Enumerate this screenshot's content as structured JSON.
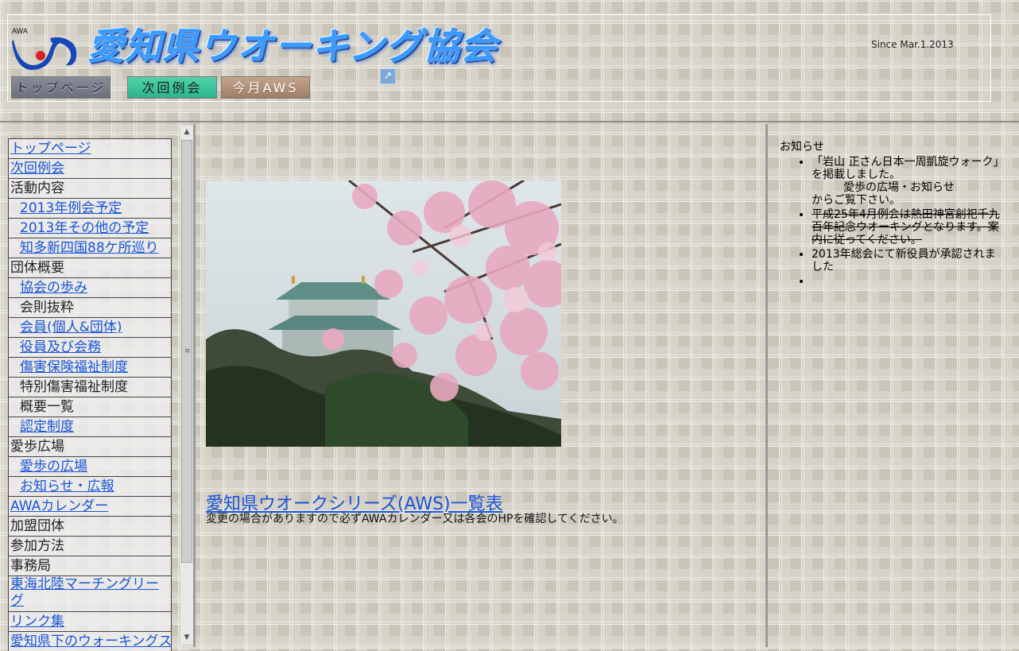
{
  "header": {
    "logo_text": "AWA",
    "site_title": "愛知県ウオーキング協会",
    "since": "Since Mar.1.2013",
    "nav": [
      {
        "label": "トップページ"
      },
      {
        "label": "次回例会"
      },
      {
        "label": "今月AWS"
      }
    ]
  },
  "sidebar": {
    "items": [
      {
        "label": "トップページ",
        "kind": "link",
        "level": 0
      },
      {
        "label": "次回例会",
        "kind": "link",
        "level": 0
      },
      {
        "label": "活動内容",
        "kind": "static",
        "level": 0
      },
      {
        "label": "2013年例会予定",
        "kind": "link",
        "level": 1
      },
      {
        "label": "2013年その他の予定",
        "kind": "link",
        "level": 1
      },
      {
        "label": "知多新四国88ケ所巡り",
        "kind": "link",
        "level": 1
      },
      {
        "label": "団体概要",
        "kind": "static",
        "level": 0
      },
      {
        "label": "協会の歩み",
        "kind": "link",
        "level": 1
      },
      {
        "label": "会則抜粋",
        "kind": "static",
        "level": 1
      },
      {
        "label": "会員(個人&団体)",
        "kind": "link",
        "level": 1
      },
      {
        "label": "役員及び会務",
        "kind": "link",
        "level": 1
      },
      {
        "label": "傷害保険福祉制度",
        "kind": "link",
        "level": 1
      },
      {
        "label": "特別傷害福祉制度",
        "kind": "static",
        "level": 1
      },
      {
        "label": "概要一覧",
        "kind": "static",
        "level": 1
      },
      {
        "label": "認定制度",
        "kind": "link",
        "level": 1
      },
      {
        "label": "愛歩広場",
        "kind": "static",
        "level": 0
      },
      {
        "label": "愛歩の広場",
        "kind": "link",
        "level": 1
      },
      {
        "label": "お知らせ・広報",
        "kind": "link",
        "level": 1
      },
      {
        "label": "AWAカレンダー",
        "kind": "link",
        "level": 0
      },
      {
        "label": "加盟団体",
        "kind": "static",
        "level": 0
      },
      {
        "label": "参加方法",
        "kind": "static",
        "level": 0
      },
      {
        "label": "事務局",
        "kind": "static",
        "level": 0
      },
      {
        "label": "東海北陸マーチングリーグ",
        "kind": "link",
        "level": 0,
        "tall": true
      },
      {
        "label": "リンク集",
        "kind": "link",
        "level": 0
      },
      {
        "label": "愛知県下のウォーキングステ",
        "kind": "link",
        "level": 0
      }
    ]
  },
  "main": {
    "aws_link": "愛知県ウオークシリーズ(AWS)一覧表",
    "aws_note": "変更の場合がありますので必ずAWAカレンダー又は各会のHPを確認してください。"
  },
  "news": {
    "title": "お知らせ",
    "items": [
      {
        "line1": "「岩山 正さん日本一周凱旋ウォーク」を掲載しました。",
        "line2": "愛歩の広場・お知らせ",
        "line3": "からご覧下さい。"
      },
      {
        "line1": "平成25年4月例会は熱田神宮創祀千九百年記念ウオーキングとなります。案内に従ってください。"
      },
      {
        "line1": "2013年総会にて新役員が承認されました"
      },
      {
        "line1": ""
      }
    ]
  },
  "colors": {
    "link": "#1a54d6",
    "title_blue": "#3a9bff"
  }
}
